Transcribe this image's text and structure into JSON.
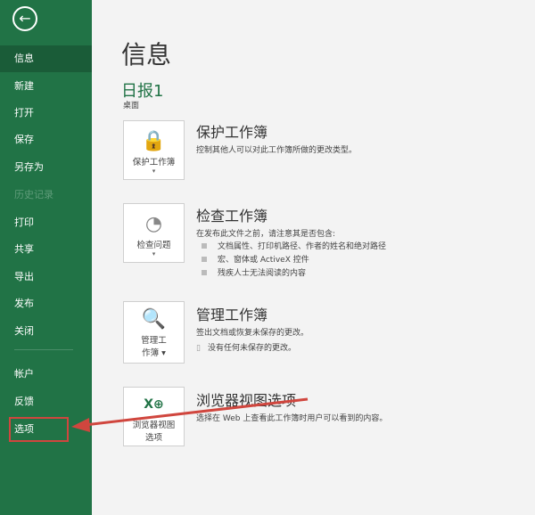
{
  "sidebar": {
    "back_icon": "arrow-left-icon",
    "items": [
      {
        "label": "信息",
        "state": "selected"
      },
      {
        "label": "新建"
      },
      {
        "label": "打开"
      },
      {
        "label": "保存"
      },
      {
        "label": "另存为"
      },
      {
        "label": "历史记录",
        "state": "disabled"
      },
      {
        "label": "打印"
      },
      {
        "label": "共享"
      },
      {
        "label": "导出"
      },
      {
        "label": "发布"
      },
      {
        "label": "关闭"
      },
      {
        "label": "帐户"
      },
      {
        "label": "反馈"
      },
      {
        "label": "选项",
        "state": "highlighted"
      }
    ]
  },
  "main": {
    "title": "信息",
    "doc_name": "日报1",
    "location": "桌面",
    "sections": [
      {
        "button": "保护工作簿",
        "heading": "保护工作簿",
        "desc": "控制其他人可以对此工作簿所做的更改类型。"
      },
      {
        "button": "检查问题",
        "heading": "检查工作簿",
        "desc": "在发布此文件之前，请注意其是否包含:",
        "bullets": [
          "文档属性、打印机路径、作者的姓名和绝对路径",
          "宏、窗体或 ActiveX 控件",
          "残疾人士无法阅读的内容"
        ]
      },
      {
        "button_line1": "管理工",
        "button_line2": "作簿 ▾",
        "heading": "管理工作簿",
        "desc": "签出文档或恢复未保存的更改。",
        "note": "没有任何未保存的更改。"
      },
      {
        "button_line1": "浏览器视图",
        "button_line2": "选项",
        "heading": "浏览器视图选项",
        "desc": "选择在 Web 上查看此工作簿时用户可以看到的内容。"
      }
    ]
  },
  "colors": {
    "sidebar": "#217346",
    "annotation": "#d0463e"
  }
}
